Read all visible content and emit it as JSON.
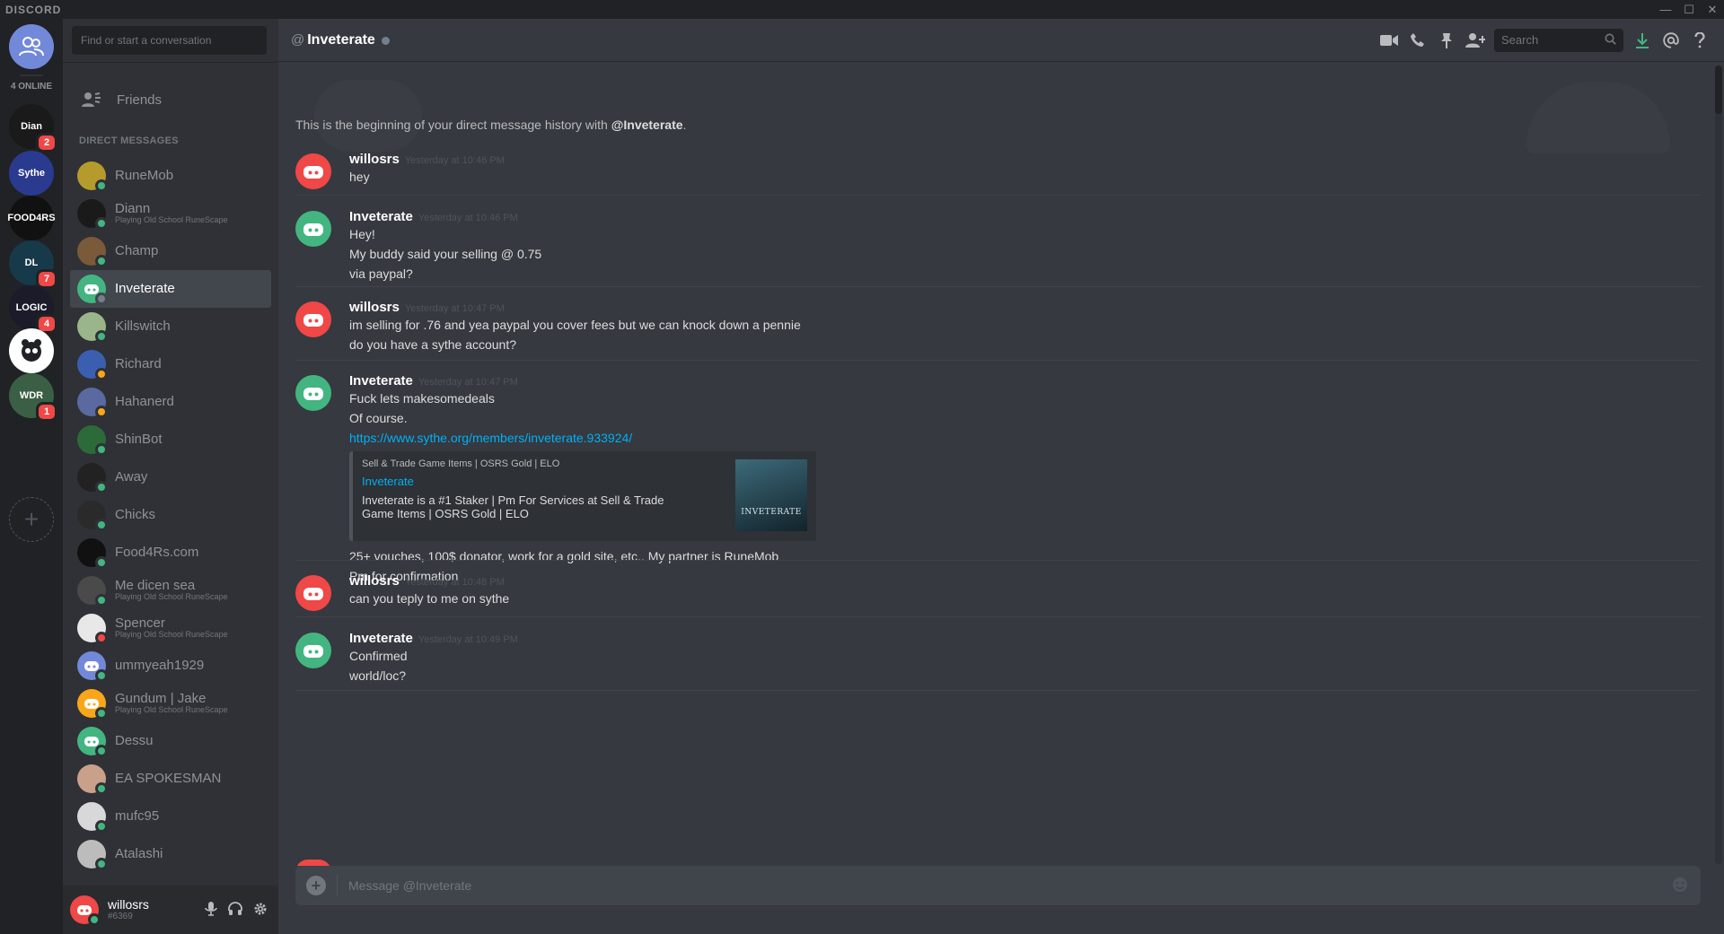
{
  "titlebar": {
    "brand": "DISCORD",
    "minimize": "—",
    "maximize": "☐",
    "close": "✕"
  },
  "servers": {
    "online_count": "4 ONLINE",
    "items": [
      {
        "label": "Dian",
        "badge": "2",
        "color": "#1a1a1a"
      },
      {
        "label": "Sythe",
        "badge": "",
        "color": "#2a3a8f"
      },
      {
        "label": "FOOD4RS",
        "badge": "",
        "color": "#111111"
      },
      {
        "label": "DL",
        "badge": "7",
        "color": "#173a4a"
      },
      {
        "label": "LOGIC",
        "badge": "4",
        "color": "#1b1b2a"
      },
      {
        "label": "",
        "badge": "",
        "color": "#ffffff"
      },
      {
        "label": "WDR",
        "badge": "1",
        "color": "#3b5f45"
      }
    ],
    "add_label": "+"
  },
  "dm_sidebar": {
    "search_placeholder": "Find or start a conversation",
    "friends_label": "Friends",
    "header": "DIRECT MESSAGES",
    "items": [
      {
        "name": "RuneMob",
        "sub": "",
        "color": "#b59a2c",
        "status": "#43b581",
        "active": false
      },
      {
        "name": "Diann",
        "sub": "Playing Old School RuneScape",
        "color": "#1a1a1a",
        "status": "#43b581",
        "active": false
      },
      {
        "name": "Champ",
        "sub": "",
        "color": "#7a5a3a",
        "status": "#43b581",
        "active": false
      },
      {
        "name": "Inveterate",
        "sub": "",
        "color": "#43b581",
        "status": "#747f8d",
        "active": true
      },
      {
        "name": "Killswitch",
        "sub": "",
        "color": "#9bb58a",
        "status": "#43b581",
        "active": false
      },
      {
        "name": "Richard",
        "sub": "",
        "color": "#3b5fb0",
        "status": "#faa61a",
        "active": false
      },
      {
        "name": "Hahanerd",
        "sub": "",
        "color": "#5a6aa0",
        "status": "#faa61a",
        "active": false
      },
      {
        "name": "ShinBot",
        "sub": "",
        "color": "#2c6a3a",
        "status": "#43b581",
        "active": false
      },
      {
        "name": "Away",
        "sub": "",
        "color": "#222222",
        "status": "#43b581",
        "active": false
      },
      {
        "name": "Chicks",
        "sub": "",
        "color": "#2a2a2a",
        "status": "#43b581",
        "active": false
      },
      {
        "name": "Food4Rs.com",
        "sub": "",
        "color": "#111111",
        "status": "#43b581",
        "active": false
      },
      {
        "name": "Me dicen sea",
        "sub": "Playing Old School RuneScape",
        "color": "#4a4a4a",
        "status": "#43b581",
        "active": false
      },
      {
        "name": "Spencer",
        "sub": "Playing Old School RuneScape",
        "color": "#e8e8e8",
        "status": "#f04747",
        "active": false
      },
      {
        "name": "ummyeah1929",
        "sub": "",
        "color": "#7289da",
        "status": "#43b581",
        "active": false
      },
      {
        "name": "Gundum | Jake",
        "sub": "Playing Old School RuneScape",
        "color": "#faa61a",
        "status": "#43b581",
        "active": false
      },
      {
        "name": "Dessu",
        "sub": "",
        "color": "#43b581",
        "status": "#43b581",
        "active": false
      },
      {
        "name": "EA SPOKESMAN",
        "sub": "",
        "color": "#c9a08a",
        "status": "#43b581",
        "active": false
      },
      {
        "name": "mufc95",
        "sub": "",
        "color": "#d8d8d8",
        "status": "#43b581",
        "active": false
      },
      {
        "name": "Atalashi",
        "sub": "",
        "color": "#bcbcbc",
        "status": "#43b581",
        "active": false
      }
    ]
  },
  "user": {
    "name": "willosrs",
    "tag": "#6369"
  },
  "chat": {
    "at": "@",
    "title": "Inveterate",
    "search_placeholder": "Search",
    "beginning_prefix": "This is the beginning of your direct message history with ",
    "beginning_user": "@Inveterate",
    "beginning_suffix": ".",
    "composer_placeholder": "Message @Inveterate",
    "messages": [
      {
        "author": "willosrs",
        "time": "Yesterday at 10:46 PM",
        "lines": [
          "hey"
        ]
      },
      {
        "author": "Inveterate",
        "time": "Yesterday at 10:46 PM",
        "lines": [
          "Hey!",
          "My buddy said your selling @ 0.75",
          "via paypal?"
        ]
      },
      {
        "author": "willosrs",
        "time": "Yesterday at 10:47 PM",
        "lines": [
          "im selling for .76 and yea paypal you cover fees but we can knock down a pennie",
          "do you have a sythe account?"
        ]
      },
      {
        "author": "Inveterate",
        "time": "Yesterday at 10:47 PM",
        "lines": [
          "Fuck  lets makesomedeals",
          "Of course."
        ],
        "link": "https://www.sythe.org/members/inveterate.933924/",
        "after": [
          "25+ vouches, 100$ donator, work for a gold site, etc.. My partner is RuneMob",
          "Pm for confirmation"
        ]
      },
      {
        "author": "willosrs",
        "time": "Yesterday at 10:48 PM",
        "lines": [
          "can you teply to me on sythe"
        ]
      },
      {
        "author": "Inveterate",
        "time": "Yesterday at 10:49 PM",
        "lines": [
          "Confirmed",
          "world/loc?"
        ]
      }
    ],
    "embed": {
      "provider": "Sell & Trade Game Items | OSRS Gold | ELO",
      "title": "Inveterate",
      "description": "Inveterate is a #1 Staker | Pm For Services at Sell & Trade Game Items | OSRS Gold | ELO",
      "thumb_text": "INVETERATE"
    }
  },
  "colors": {
    "willosrs_avatar": "#f04747",
    "inveterate_avatar": "#43b581",
    "link": "#00b0f4"
  }
}
